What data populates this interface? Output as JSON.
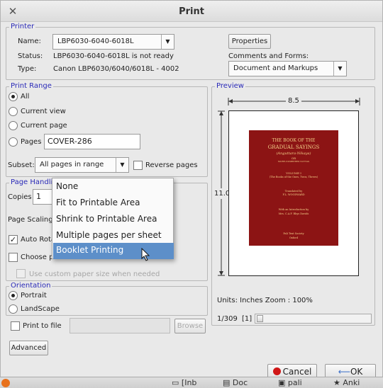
{
  "window": {
    "title": "Print",
    "close_glyph": "✕"
  },
  "printer": {
    "legend": "Printer",
    "name_label": "Name:",
    "name_value": "LBP6030-6040-6018L",
    "status_label": "Status:",
    "status_value": "LBP6030-6040-6018L is not ready",
    "type_label": "Type:",
    "type_value": "Canon LBP6030/6040/6018L -  4002",
    "properties_button": "Properties",
    "comments_label": "Comments and Forms:",
    "comments_value": "Document and Markups"
  },
  "print_range": {
    "legend": "Print Range",
    "options": [
      "All",
      "Current view",
      "Current page",
      "Pages"
    ],
    "selected": "All",
    "pages_value": "COVER-286",
    "subset_label": "Subset:",
    "subset_value": "All pages in range",
    "reverse_label": "Reverse pages"
  },
  "page_handling": {
    "legend": "Page Handling",
    "copies_label": "Copies",
    "copies_value": "1",
    "scaling_label": "Page Scaling",
    "auto_rotate_label": "Auto Rota",
    "auto_rotate_checked": true,
    "choose_paper_label": "Choose p",
    "custom_size_label": "Use custom paper size when needed"
  },
  "scaling_menu": {
    "items": [
      "None",
      "Fit to Printable Area",
      "Shrink to Printable Area",
      "Multiple pages per sheet",
      "Booklet Printing"
    ],
    "highlighted": "Booklet Printing"
  },
  "orientation": {
    "legend": "Orientation",
    "options": [
      "Portrait",
      "LandScape"
    ],
    "selected": "Portrait"
  },
  "print_to_file": {
    "label": "Print to file",
    "browse_button": "Browse"
  },
  "advanced_button": "Advanced",
  "preview": {
    "legend": "Preview",
    "width_label": "8.5",
    "height_label": "11.0",
    "units_text": "Units: Inches Zoom : 100%",
    "page_counter": "1/309",
    "page_index": "[1]",
    "book": {
      "title1": "THE BOOK OF THE",
      "title2": "GRADUAL SAYINGS",
      "title3": "(Anguttara-Nikaya)",
      "or": "OR",
      "more": "MORE-NUMBERED SUTTAS",
      "volume": "VOLUME I",
      "volume_sub": "(The Books of the Ones, Twos, Threes)",
      "translated": "Translated by",
      "translator": "F.L. WOODWARD",
      "intro": "With an Introduction by",
      "intro_author": "Mrs. C.A.F. Rhys Davids",
      "publisher": "Pali Text Society",
      "city": "Oxford"
    }
  },
  "buttons": {
    "cancel": "Cancel",
    "ok": "OK"
  },
  "taskbar": {
    "items": [
      "[Inb",
      "Doc",
      "pali",
      "Anki"
    ]
  },
  "colors": {
    "accent_blue": "#2a2ab8",
    "menu_highlight": "#5d8fc9",
    "book_red": "#8c1414"
  }
}
